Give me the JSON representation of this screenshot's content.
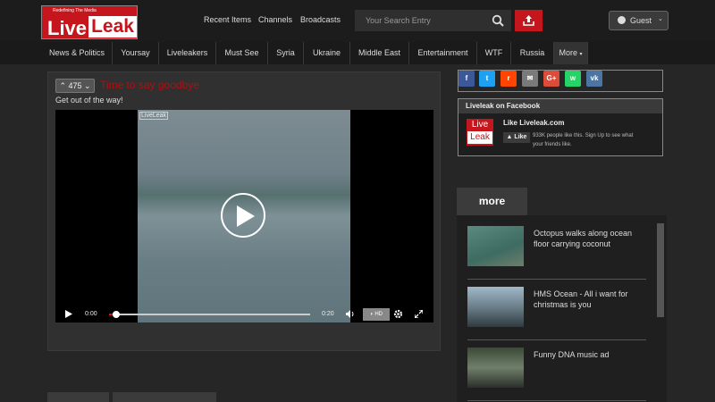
{
  "site": {
    "tagline": "Redefining The Media",
    "logo_live": "Live",
    "logo_leak": "Leak"
  },
  "header": {
    "links": [
      "Recent Items",
      "Channels",
      "Broadcasts"
    ],
    "search_placeholder": "Your Search Entry",
    "guest_label": "Guest"
  },
  "nav": {
    "items": [
      "News & Politics",
      "Yoursay",
      "Liveleakers",
      "Must See",
      "Syria",
      "Ukraine",
      "Middle East",
      "Entertainment",
      "WTF",
      "Russia"
    ],
    "more_label": "More"
  },
  "video": {
    "votes": "475",
    "title": "Time to say goodbye",
    "subtitle": "Get out of the way!",
    "watermark": "LiveLeak",
    "time_current": "0:00",
    "time_total": "0:20",
    "hd_label": "HD",
    "progress": 0.02
  },
  "social": {
    "buttons": [
      {
        "icon": "facebook-icon",
        "glyph": "f",
        "color": "#3b5998"
      },
      {
        "icon": "twitter-icon",
        "glyph": "t",
        "color": "#1da1f2"
      },
      {
        "icon": "reddit-icon",
        "glyph": "r",
        "color": "#ff4500"
      },
      {
        "icon": "email-icon",
        "glyph": "✉",
        "color": "#7a7a7a"
      },
      {
        "icon": "google-plus-icon",
        "glyph": "G+",
        "color": "#dd4b39"
      },
      {
        "icon": "whatsapp-icon",
        "glyph": "w",
        "color": "#25d366"
      },
      {
        "icon": "vk-icon",
        "glyph": "vk",
        "color": "#4c75a3"
      }
    ]
  },
  "facebook": {
    "header": "Liveleak on Facebook",
    "page_name": "Like Liveleak.com",
    "like_label": "Like",
    "description": "933K people like this. Sign Up to see what your friends like.",
    "logo_live": "Live",
    "logo_leak": "Leak"
  },
  "more": {
    "tab_label": "more",
    "items": [
      {
        "title": "Octopus walks along ocean floor carrying coconut"
      },
      {
        "title": "HMS Ocean - All i want for christmas is you"
      },
      {
        "title": "Funny DNA music ad"
      }
    ]
  }
}
